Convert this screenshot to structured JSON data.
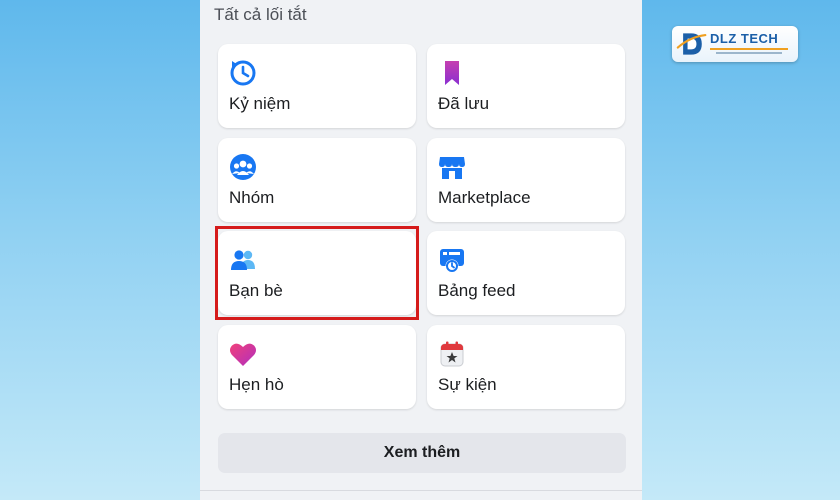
{
  "section_title": "Tất cả lối tắt",
  "shortcuts": [
    {
      "label": "Kỷ niệm",
      "icon": "memories-clock-icon"
    },
    {
      "label": "Đã lưu",
      "icon": "saved-bookmark-icon"
    },
    {
      "label": "Nhóm",
      "icon": "groups-icon"
    },
    {
      "label": "Marketplace",
      "icon": "marketplace-store-icon"
    },
    {
      "label": "Bạn bè",
      "icon": "friends-icon"
    },
    {
      "label": "Bảng feed",
      "icon": "feeds-icon"
    },
    {
      "label": "Hẹn hò",
      "icon": "dating-heart-icon"
    },
    {
      "label": "Sự kiện",
      "icon": "events-calendar-icon"
    }
  ],
  "see_more_label": "Xem thêm",
  "watermark": {
    "brand": "DLZ TECH"
  },
  "colors": {
    "highlight": "#d51b1b",
    "accent_blue": "#1877f2",
    "card_bg": "#ffffff",
    "panel_bg": "#f0f2f5"
  }
}
